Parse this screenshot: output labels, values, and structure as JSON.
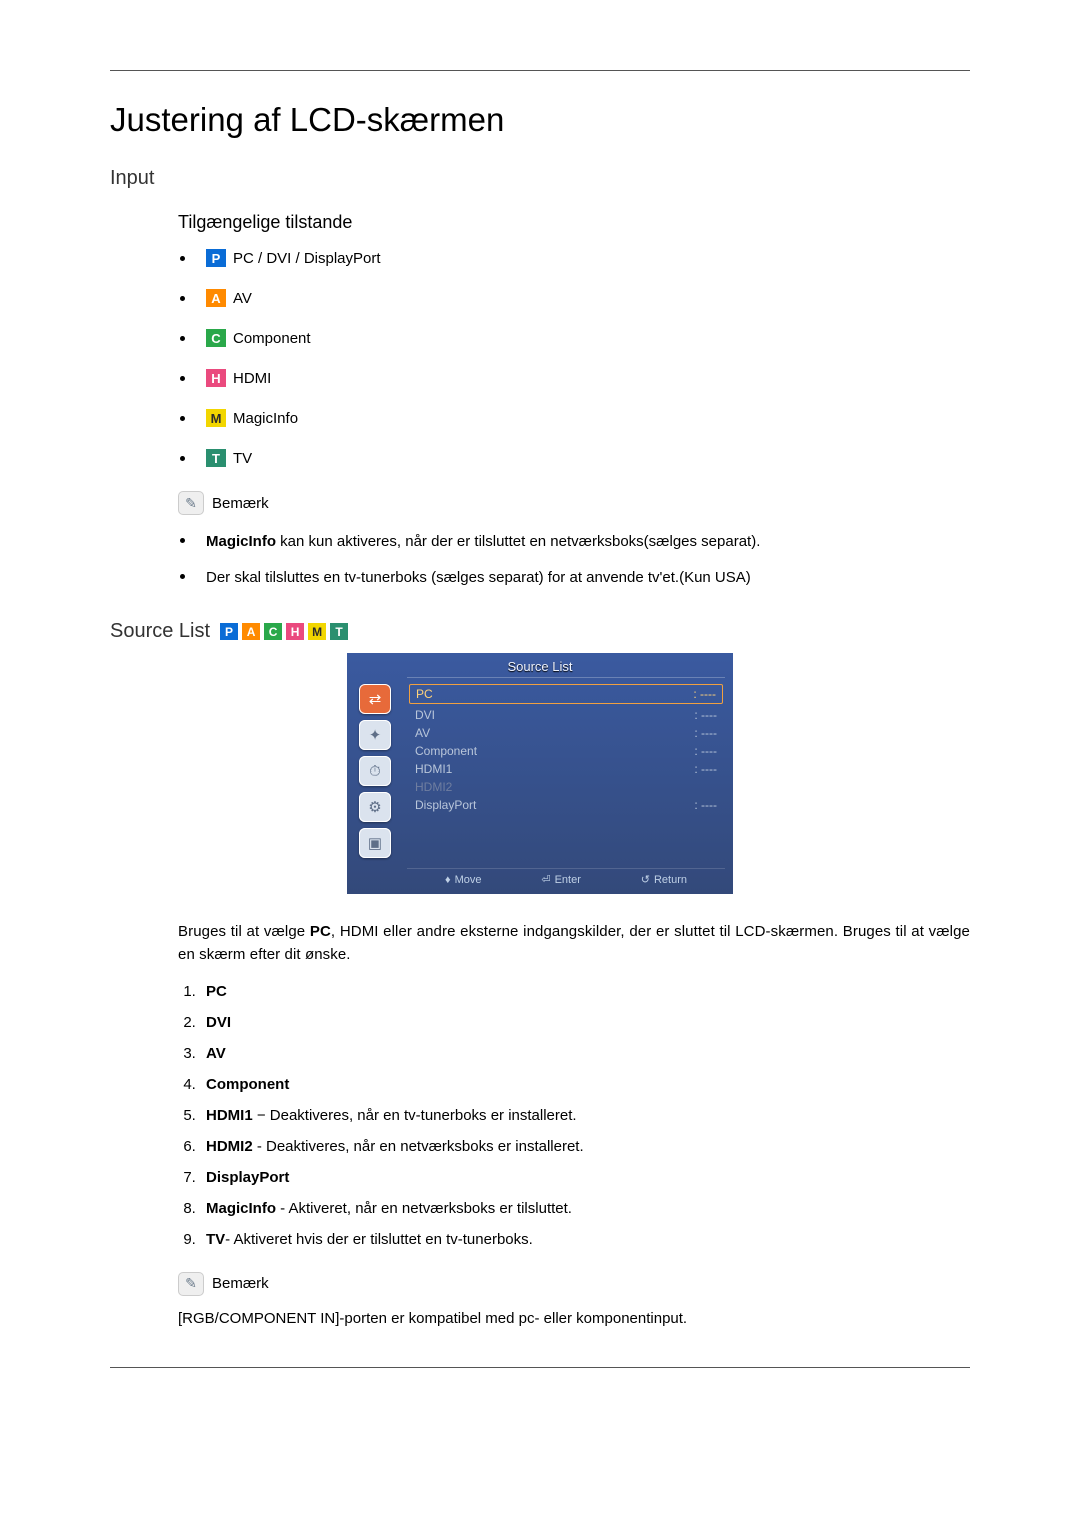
{
  "title": "Justering af LCD-skærmen",
  "section_input": "Input",
  "subsection_modes": "Tilgængelige tilstande",
  "modes": {
    "pc": "PC / DVI / DisplayPort",
    "av": "AV",
    "component": "Component",
    "hdmi": "HDMI",
    "magicinfo": "MagicInfo",
    "tv": "TV"
  },
  "badge_letters": {
    "p": "P",
    "a": "A",
    "c": "C",
    "h": "H",
    "m": "M",
    "t": "T"
  },
  "note_label": "Bemærk",
  "notes_top": {
    "n1_bold": "MagicInfo",
    "n1_rest": " kan kun aktiveres, når der er tilsluttet en netværksboks(sælges separat).",
    "n2": "Der skal tilsluttes en tv-tunerboks (sælges separat) for at anvende tv'et.(Kun USA)"
  },
  "source_list_label": "Source List",
  "osd": {
    "title": "Source List",
    "rows": [
      {
        "name": "PC",
        "val": ": ‑‑‑‑",
        "cls": "sel"
      },
      {
        "name": "DVI",
        "val": ": ‑‑‑‑",
        "cls": ""
      },
      {
        "name": "AV",
        "val": ": ‑‑‑‑",
        "cls": ""
      },
      {
        "name": "Component",
        "val": ": ‑‑‑‑",
        "cls": ""
      },
      {
        "name": "HDMI1",
        "val": ": ‑‑‑‑",
        "cls": ""
      },
      {
        "name": "HDMI2",
        "val": "",
        "cls": "dim"
      },
      {
        "name": "DisplayPort",
        "val": ": ‑‑‑‑",
        "cls": ""
      }
    ],
    "footer": {
      "move": "Move",
      "enter": "Enter",
      "return": "Return"
    }
  },
  "body_para_pre": "Bruges til at vælge ",
  "body_para_bold": "PC",
  "body_para_post": ", HDMI eller andre eksterne indgangskilder, der er sluttet til LCD-skærmen. Bruges til at vælge en skærm efter dit ønske.",
  "src_items": {
    "i1": "PC",
    "i2": "DVI",
    "i3": "AV",
    "i4": "Component",
    "i5b": "HDMI1",
    "i5r": " − Deaktiveres, når en tv-tunerboks er installeret.",
    "i6b": "HDMI2",
    "i6r": " - Deaktiveres, når en netværksboks er installeret.",
    "i7": "DisplayPort",
    "i8b": "MagicInfo",
    "i8r": " - Aktiveret, når en netværksboks er tilsluttet.",
    "i9b": "TV",
    "i9r": "- Aktiveret hvis der er tilsluttet en tv-tunerboks."
  },
  "footer_note": "[RGB/COMPONENT IN]-porten er kompatibel med pc- eller komponentinput."
}
